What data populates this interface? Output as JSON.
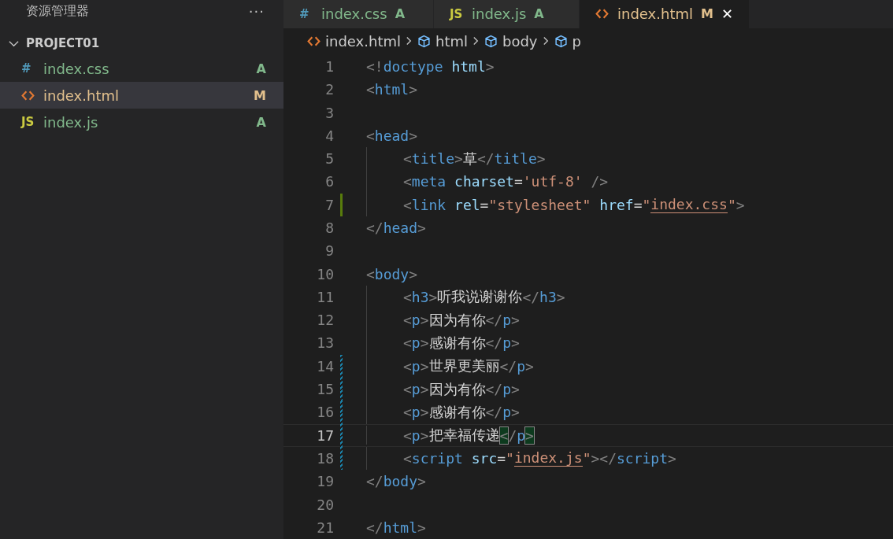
{
  "sidebar": {
    "title": "资源管理器",
    "more": "···",
    "project": {
      "name": "PROJECT01",
      "expanded": true
    },
    "files": [
      {
        "name": "index.css",
        "kind": "css",
        "icon": "#",
        "status": "A",
        "color": "#81b88b",
        "selected": false
      },
      {
        "name": "index.html",
        "kind": "html",
        "status": "M",
        "color": "#e2c08d",
        "selected": true
      },
      {
        "name": "index.js",
        "kind": "js",
        "icon": "JS",
        "status": "A",
        "color": "#81b88b",
        "selected": false
      }
    ]
  },
  "tabs": [
    {
      "label": "index.css",
      "kind": "css",
      "icon": "#",
      "status": "A",
      "color": "#81b88b",
      "selected": false
    },
    {
      "label": "index.js",
      "kind": "js",
      "icon": "JS",
      "status": "A",
      "color": "#81b88b",
      "selected": false
    },
    {
      "label": "index.html",
      "kind": "html",
      "status": "M",
      "color": "#e2c08d",
      "selected": true,
      "close": "✕"
    }
  ],
  "breadcrumb": [
    {
      "kind": "file",
      "text": "index.html"
    },
    {
      "kind": "element",
      "text": "html"
    },
    {
      "kind": "element",
      "text": "body"
    },
    {
      "kind": "element",
      "text": "p"
    }
  ],
  "code": [
    {
      "number": "1",
      "tokens": [
        {
          "kind": "punct",
          "t": "<!"
        },
        {
          "kind": "tag",
          "t": "doctype"
        },
        {
          "kind": "attr",
          "t": " html"
        },
        {
          "kind": "punct",
          "t": ">"
        }
      ]
    },
    {
      "number": "2",
      "tokens": [
        {
          "kind": "punct",
          "t": "<"
        },
        {
          "kind": "tag",
          "t": "html"
        },
        {
          "kind": "punct",
          "t": ">"
        }
      ]
    },
    {
      "number": "3"
    },
    {
      "number": "4",
      "tokens": [
        {
          "kind": "punct",
          "t": "<"
        },
        {
          "kind": "tag",
          "t": "head"
        },
        {
          "kind": "punct",
          "t": ">"
        }
      ]
    },
    {
      "number": "5",
      "indented": true,
      "tokens": [
        {
          "kind": "punct",
          "t": "<"
        },
        {
          "kind": "tag",
          "t": "title"
        },
        {
          "kind": "punct",
          "t": ">"
        },
        {
          "kind": "text",
          "t": "草"
        },
        {
          "kind": "punct",
          "t": "</"
        },
        {
          "kind": "tag",
          "t": "title"
        },
        {
          "kind": "punct",
          "t": ">"
        }
      ]
    },
    {
      "number": "6",
      "indented": true,
      "tokens": [
        {
          "kind": "punct",
          "t": "<"
        },
        {
          "kind": "tag",
          "t": "meta"
        },
        {
          "kind": "attr",
          "t": " charset"
        },
        {
          "kind": "text",
          "t": "="
        },
        {
          "kind": "string",
          "t": "'utf-8'"
        },
        {
          "kind": "punct",
          "t": " />"
        }
      ]
    },
    {
      "number": "7",
      "indented": true,
      "added": true,
      "tokens": [
        {
          "kind": "punct",
          "t": "<"
        },
        {
          "kind": "tag",
          "t": "link"
        },
        {
          "kind": "attr",
          "t": " rel"
        },
        {
          "kind": "text",
          "t": "="
        },
        {
          "kind": "string",
          "t": "\"stylesheet\""
        },
        {
          "kind": "attr",
          "t": " href"
        },
        {
          "kind": "text",
          "t": "="
        },
        {
          "kind": "string",
          "t": "\""
        },
        {
          "kind": "link",
          "t": "index.css"
        },
        {
          "kind": "string",
          "t": "\""
        },
        {
          "kind": "punct",
          "t": ">"
        }
      ]
    },
    {
      "number": "8",
      "tokens": [
        {
          "kind": "punct",
          "t": "</"
        },
        {
          "kind": "tag",
          "t": "head"
        },
        {
          "kind": "punct",
          "t": ">"
        }
      ]
    },
    {
      "number": "9"
    },
    {
      "number": "10",
      "tokens": [
        {
          "kind": "punct",
          "t": "<"
        },
        {
          "kind": "tag",
          "t": "body"
        },
        {
          "kind": "punct",
          "t": ">"
        }
      ]
    },
    {
      "number": "11",
      "indented": true,
      "tokens": [
        {
          "kind": "punct",
          "t": "<"
        },
        {
          "kind": "tag",
          "t": "h3"
        },
        {
          "kind": "punct",
          "t": ">"
        },
        {
          "kind": "text",
          "t": "听我说谢谢你"
        },
        {
          "kind": "punct",
          "t": "</"
        },
        {
          "kind": "tag",
          "t": "h3"
        },
        {
          "kind": "punct",
          "t": ">"
        }
      ]
    },
    {
      "number": "12",
      "indented": true,
      "tokens": [
        {
          "kind": "punct",
          "t": "<"
        },
        {
          "kind": "tag",
          "t": "p"
        },
        {
          "kind": "punct",
          "t": ">"
        },
        {
          "kind": "text",
          "t": "因为有你"
        },
        {
          "kind": "punct",
          "t": "</"
        },
        {
          "kind": "tag",
          "t": "p"
        },
        {
          "kind": "punct",
          "t": ">"
        }
      ]
    },
    {
      "number": "13",
      "indented": true,
      "tokens": [
        {
          "kind": "punct",
          "t": "<"
        },
        {
          "kind": "tag",
          "t": "p"
        },
        {
          "kind": "punct",
          "t": ">"
        },
        {
          "kind": "text",
          "t": "感谢有你"
        },
        {
          "kind": "punct",
          "t": "</"
        },
        {
          "kind": "tag",
          "t": "p"
        },
        {
          "kind": "punct",
          "t": ">"
        }
      ]
    },
    {
      "number": "14",
      "indented": true,
      "modified": true,
      "tokens": [
        {
          "kind": "punct",
          "t": "<"
        },
        {
          "kind": "tag",
          "t": "p"
        },
        {
          "kind": "punct",
          "t": ">"
        },
        {
          "kind": "text",
          "t": "世界更美丽"
        },
        {
          "kind": "punct",
          "t": "</"
        },
        {
          "kind": "tag",
          "t": "p"
        },
        {
          "kind": "punct",
          "t": ">"
        }
      ]
    },
    {
      "number": "15",
      "indented": true,
      "modified": true,
      "tokens": [
        {
          "kind": "punct",
          "t": "<"
        },
        {
          "kind": "tag",
          "t": "p"
        },
        {
          "kind": "punct",
          "t": ">"
        },
        {
          "kind": "text",
          "t": "因为有你"
        },
        {
          "kind": "punct",
          "t": "</"
        },
        {
          "kind": "tag",
          "t": "p"
        },
        {
          "kind": "punct",
          "t": ">"
        }
      ]
    },
    {
      "number": "16",
      "indented": true,
      "modified": true,
      "tokens": [
        {
          "kind": "punct",
          "t": "<"
        },
        {
          "kind": "tag",
          "t": "p"
        },
        {
          "kind": "punct",
          "t": ">"
        },
        {
          "kind": "text",
          "t": "感谢有你"
        },
        {
          "kind": "punct",
          "t": "</"
        },
        {
          "kind": "tag",
          "t": "p"
        },
        {
          "kind": "punct",
          "t": ">"
        }
      ]
    },
    {
      "number": "17",
      "indented": true,
      "modified": true,
      "current": true,
      "tokens": [
        {
          "kind": "punct",
          "t": "<"
        },
        {
          "kind": "tag",
          "t": "p"
        },
        {
          "kind": "punct",
          "t": ">"
        },
        {
          "kind": "text",
          "t": "把幸福传递"
        },
        {
          "kind": "match",
          "t": "<"
        },
        {
          "kind": "punct",
          "t": "/"
        },
        {
          "kind": "tag",
          "t": "p"
        },
        {
          "kind": "match",
          "t": ">"
        }
      ]
    },
    {
      "number": "18",
      "indented": true,
      "modified": true,
      "tokens": [
        {
          "kind": "punct",
          "t": "<"
        },
        {
          "kind": "tag",
          "t": "script"
        },
        {
          "kind": "attr",
          "t": " src"
        },
        {
          "kind": "text",
          "t": "="
        },
        {
          "kind": "string",
          "t": "\""
        },
        {
          "kind": "link",
          "t": "index.js"
        },
        {
          "kind": "string",
          "t": "\""
        },
        {
          "kind": "punct",
          "t": "></"
        },
        {
          "kind": "tag",
          "t": "script"
        },
        {
          "kind": "punct",
          "t": ">"
        }
      ]
    },
    {
      "number": "19",
      "tokens": [
        {
          "kind": "punct",
          "t": "</"
        },
        {
          "kind": "tag",
          "t": "body"
        },
        {
          "kind": "punct",
          "t": ">"
        }
      ]
    },
    {
      "number": "20"
    },
    {
      "number": "21",
      "tokens": [
        {
          "kind": "punct",
          "t": "</"
        },
        {
          "kind": "tag",
          "t": "html"
        },
        {
          "kind": "punct",
          "t": ">"
        }
      ]
    }
  ]
}
